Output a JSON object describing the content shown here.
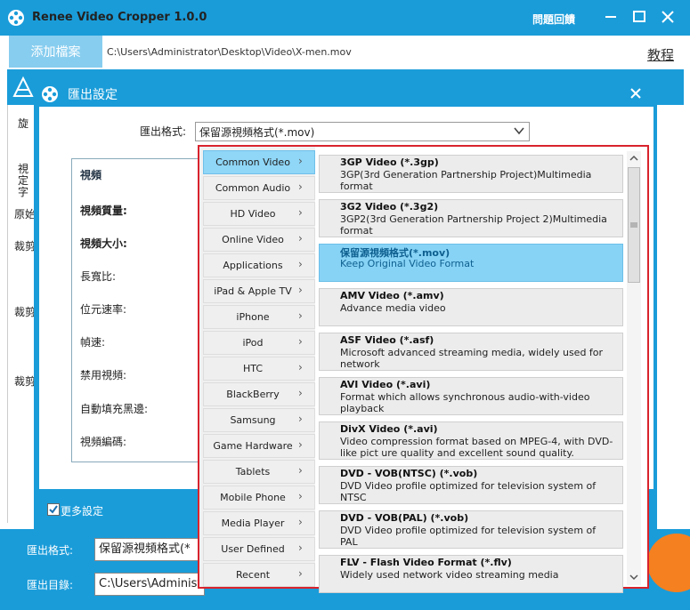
{
  "window": {
    "title": "Renee Video Cropper 1.0.0",
    "help": "問題回饋"
  },
  "toolbar": {
    "add_file": "添加檔案",
    "file_path": "C:\\Users\\Administrator\\Desktop\\Video\\X-men.mov",
    "tutorial": "教程"
  },
  "left_panel": {
    "labels": [
      "旋",
      "視",
      "定",
      "字",
      "原始",
      "裁剪",
      "裁剪",
      "裁剪"
    ]
  },
  "dialog": {
    "title": "匯出設定",
    "format_label": "匯出格式:",
    "format_value": "保留源視頻格式(*.mov)",
    "video_group_title": "視頻",
    "video_labels": [
      "視頻質量:",
      "視頻大小:",
      "長寬比:",
      "位元速率:",
      "幀速:",
      "禁用視頻:",
      "自動填充黑邊:",
      "視頻編碼:"
    ],
    "more_settings": "更多設定",
    "more_settings_checked": true
  },
  "bottom": {
    "export_format_label": "匯出格式:",
    "export_format_value": "保留源視頻格式(*",
    "export_dir_label": "匯出目錄:",
    "export_dir_value": "C:\\Users\\Administr"
  },
  "format_popup": {
    "categories": [
      "Common Video",
      "Common Audio",
      "HD Video",
      "Online Video",
      "Applications",
      "iPad & Apple TV",
      "iPhone",
      "iPod",
      "HTC",
      "BlackBerry",
      "Samsung",
      "Game Hardware",
      "Tablets",
      "Mobile Phone",
      "Media Player",
      "User Defined",
      "Recent"
    ],
    "selected_category": "Common Video",
    "formats": [
      {
        "name": "3GP Video (*.3gp)",
        "desc": "3GP(3rd Generation Partnership Project)Multimedia format"
      },
      {
        "name": "3G2 Video (*.3g2)",
        "desc": "3GP2(3rd Generation Partnership Project 2)Multimedia format"
      },
      {
        "name": "保留源視頻格式(*.mov)",
        "desc": "Keep Original Video Format"
      },
      {
        "name": "AMV Video (*.amv)",
        "desc": "Advance media video"
      },
      {
        "name": "ASF Video (*.asf)",
        "desc": "Microsoft advanced streaming media, widely used for network"
      },
      {
        "name": "AVI Video (*.avi)",
        "desc": "Format which allows synchronous audio-with-video playback"
      },
      {
        "name": "DivX Video (*.avi)",
        "desc": "Video compression format based on MPEG-4, with DVD-like pict ure quality and excellent sound quality."
      },
      {
        "name": "DVD - VOB(NTSC) (*.vob)",
        "desc": "DVD Video profile optimized for television system of NTSC"
      },
      {
        "name": "DVD - VOB(PAL) (*.vob)",
        "desc": "DVD Video profile optimized for television system of PAL"
      },
      {
        "name": "FLV - Flash Video Format (*.flv)",
        "desc": "Widely used network video streaming media"
      }
    ],
    "selected_format": "保留源視頻格式(*.mov)"
  },
  "colors": {
    "brand_blue": "#1a9cd9",
    "selected_blue": "#87d3f6",
    "highlight_border": "#d9232d",
    "start_orange": "#f5801f"
  }
}
